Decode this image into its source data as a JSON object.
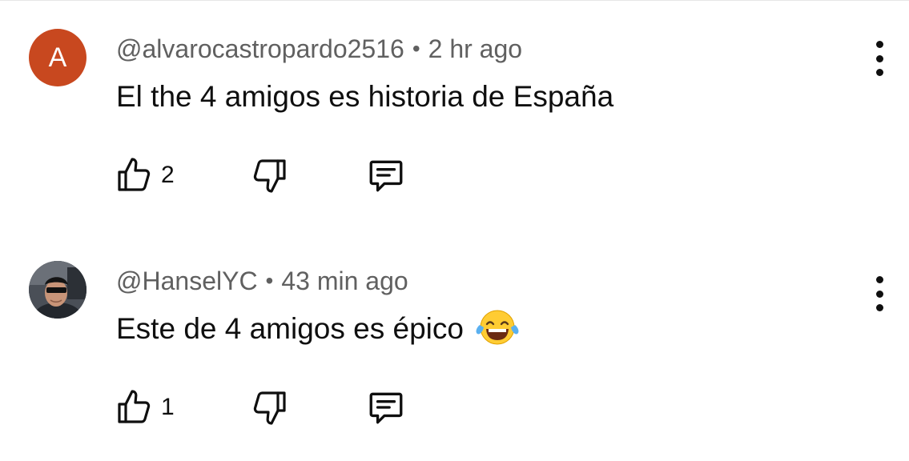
{
  "comments": [
    {
      "avatar_letter": "A",
      "avatar_color": "#c8481f",
      "username": "@alvarocastropardo2516",
      "separator": "•",
      "time": "2 hr ago",
      "text": "El the 4 amigos es historia de España",
      "likes": "2",
      "emoji": ""
    },
    {
      "avatar_letter": "",
      "username": "@HanselYC",
      "separator": "•",
      "time": "43 min ago",
      "text": "Este de 4 amigos es épico",
      "likes": "1",
      "emoji": "face-with-tears-of-joy-emoji"
    }
  ],
  "icons": {
    "like": "thumbs-up-icon",
    "dislike": "thumbs-down-icon",
    "reply": "reply-comment-icon",
    "more": "more-vertical-icon"
  },
  "colors": {
    "meta_text": "#606060",
    "primary_text": "#0f0f0f"
  }
}
